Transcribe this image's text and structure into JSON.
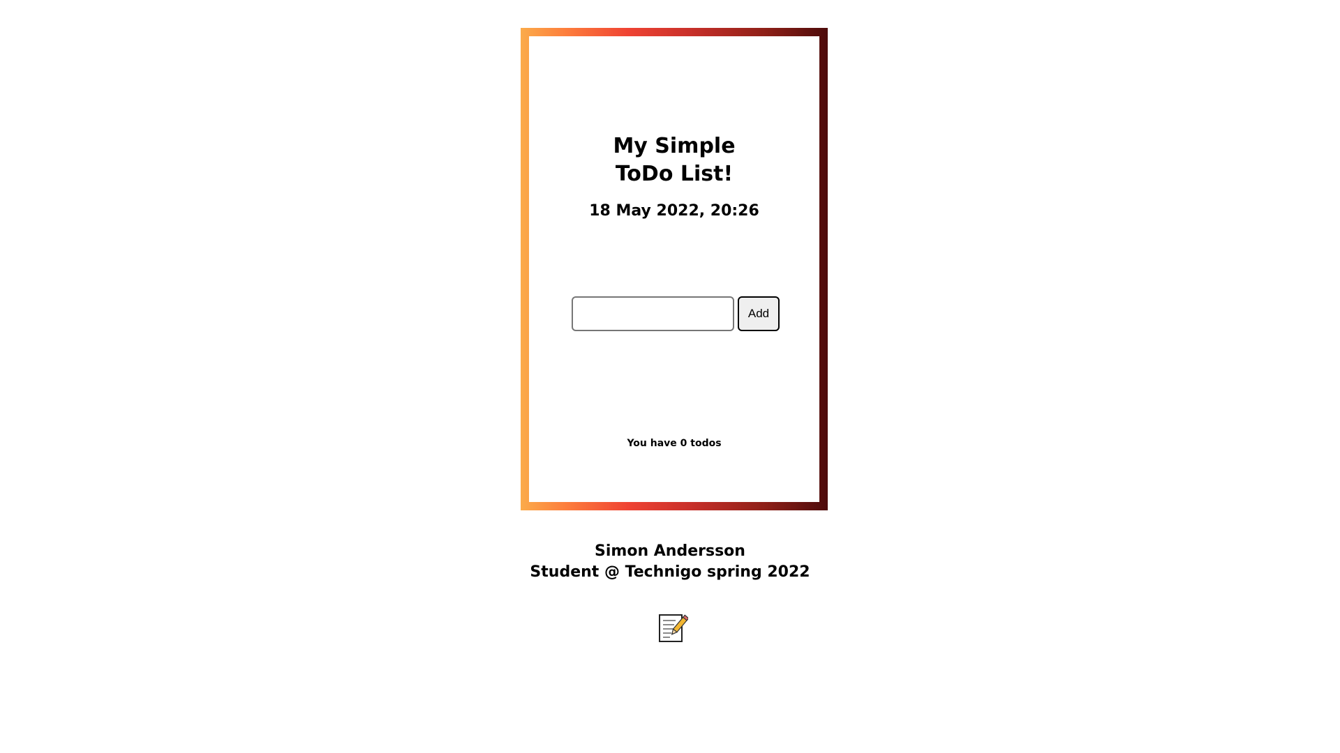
{
  "app": {
    "title": "My Simple ToDo List!",
    "datetime": "18 May 2022, 20:26"
  },
  "form": {
    "input_value": "",
    "input_placeholder": "",
    "add_label": "Add"
  },
  "status": {
    "todo_count_text": "You have 0 todos"
  },
  "footer": {
    "author": "Simon Andersson",
    "subtitle": "Student @ Technigo spring 2022",
    "icon": "notepad-icon"
  },
  "colors": {
    "gradient_start": "#fbab4a",
    "gradient_mid": "#ef4333",
    "gradient_end": "#4d0b0b",
    "background": "#ffffff"
  }
}
